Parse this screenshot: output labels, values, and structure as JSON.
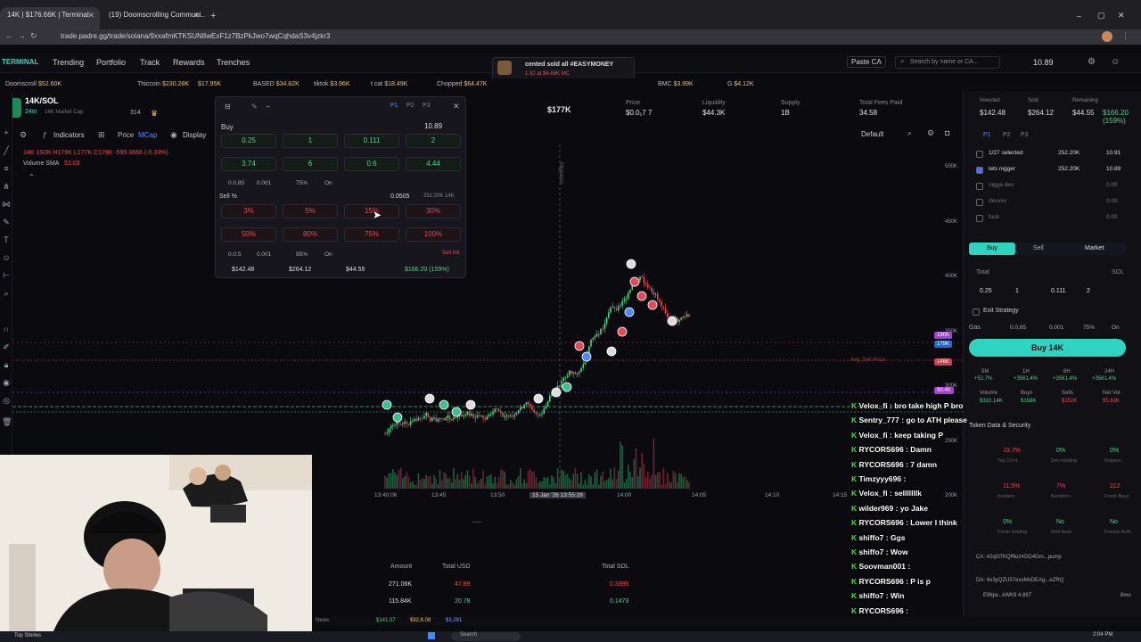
{
  "browser": {
    "tabs": [
      {
        "label": "14K | $176.66K | Terminal"
      },
      {
        "label": "(19) Doomscrolling Communi..."
      }
    ],
    "url": "trade.padre.gg/trade/solana/9xxafmKTKSUN8wExF1z7BzPkJwo7wqCqhdaS3v4jzkr3"
  },
  "nav": {
    "brand": "TERMINAL",
    "items": [
      "Trending",
      "Portfolio",
      "Track",
      "Rewards",
      "Trenches"
    ],
    "paste": "Paste CA",
    "search_placeholder": "Search by name or CA...",
    "balance": "10.89"
  },
  "notification": {
    "text": "cented sold all #EASYMONEY",
    "sub": "1.92 at $4.66K MC"
  },
  "ticker": [
    {
      "name": "Doomscroll",
      "value": "$52.60K"
    },
    {
      "name": "Thiccoin",
      "value": "$230.28K"
    },
    {
      "name": "",
      "value": "$17.95K"
    },
    {
      "name": "BASED",
      "value": "$34.82K"
    },
    {
      "name": "tiktok",
      "value": "$3.96K"
    },
    {
      "name": "t cat",
      "value": "$18.49K"
    },
    {
      "name": "Chopped",
      "value": "$64.47K"
    },
    {
      "name": "BMC",
      "value": "$3.99K"
    },
    {
      "name": "G",
      "value": "$4.12K"
    }
  ],
  "token": {
    "pair": "14K/SOL",
    "age": "24m",
    "subtitle": "14K Market Cap",
    "holders": "314",
    "ohlc": "14K 1S0K H179K L177K C179K -599.3666 (-0.33%)",
    "volume_label": "Volume SMA",
    "volume_value": "52.03"
  },
  "chart_toolbar": {
    "indicators": "Indicators",
    "price": "Price",
    "mcap": "MCap",
    "display": "Display",
    "default": "Default"
  },
  "stats": [
    {
      "label": "",
      "value": "$177K"
    },
    {
      "label": "Price",
      "value": "$0.0₁7 7"
    },
    {
      "label": "Liquidity",
      "value": "$44.3K"
    },
    {
      "label": "Supply",
      "value": "1B"
    },
    {
      "label": "Total Fees Paid",
      "value": "34.58"
    }
  ],
  "popup": {
    "buy_label": "Buy",
    "balance": "10.89",
    "buy_amounts": [
      "0.25",
      "1",
      "0.111",
      "2",
      "3.74",
      "6",
      "0.6",
      "4.44"
    ],
    "buy_settings": [
      "0.0,85",
      "0.001",
      "75%",
      "On"
    ],
    "sell_label": "Sell %",
    "sell_info": "0.0505",
    "sell_info2": "252.20K 14K",
    "sell_pcts": [
      "3%",
      "5%",
      "15%",
      "30%",
      "50%",
      "80%",
      "75%",
      "100%"
    ],
    "sell_settings": [
      "0.0,5",
      "0.001",
      "95%",
      "On"
    ],
    "sell_init": "Sell init",
    "totals": [
      "$142.48",
      "$264.12",
      "$44.55",
      "$166.20 (159%)"
    ]
  },
  "chart": {
    "price_axis": [
      "500K",
      "450K",
      "400K",
      "350K",
      "300K",
      "250K",
      "200K",
      "150K",
      "100K"
    ],
    "time_axis": [
      "13:40:06",
      "13:45",
      "13:50",
      "15 Jan '26 13:55:28",
      "14:00",
      "14:05",
      "14:10",
      "14:15"
    ],
    "tags": [
      {
        "text": "190K",
        "color": "#a23fd6"
      },
      {
        "text": "179K",
        "color": "#1e6bd6"
      },
      {
        "text": "146K",
        "color": "#d13b4c"
      },
      {
        "text": "90.4K",
        "color": "#a23fd6"
      }
    ],
    "avg_label": "Avg. Sell Price",
    "migration_label": "Migration"
  },
  "right_panel": {
    "invested": "$142.48",
    "sold": "$264.12",
    "remaining": "$44.55",
    "pnl": "$166.20 (159%)",
    "presets": [
      "P1",
      "P2",
      "P3"
    ],
    "wallets": [
      {
        "name": "1/27 selected",
        "value": "252.20K",
        "sol": "10.91"
      },
      {
        "name": "lets nigger",
        "value": "252.20K",
        "sol": "10.89"
      },
      {
        "name": "nigga dev",
        "value": "",
        "sol": "0.00"
      },
      {
        "name": "devvvv",
        "value": "",
        "sol": "0.00"
      },
      {
        "name": "fuck",
        "value": "",
        "sol": "0.00"
      }
    ],
    "tabs": [
      "Buy",
      "Sell",
      "Market"
    ],
    "amount_label": "Total",
    "currency": "SOL",
    "quick": [
      "0.25",
      "1",
      "0.111",
      "2"
    ],
    "exit_strategy": "Exit Strategy",
    "gas_label": "Gas",
    "gas": [
      "0.0,85",
      "0.001",
      "75%",
      "On"
    ],
    "buy_button": "Buy 14K",
    "timeframes": [
      {
        "tf": "5M",
        "v": "+52.7%"
      },
      {
        "tf": "1H",
        "v": "+3561.4%"
      },
      {
        "tf": "6H",
        "v": "+3561.4%"
      },
      {
        "tf": "24H",
        "v": "+3561.4%"
      }
    ],
    "volume_row": [
      "Volume",
      "Buys",
      "Sells",
      "Net Vol."
    ],
    "volume_vals": [
      "$310.14K",
      "$158K",
      "$152K",
      "$5.63K"
    ],
    "security_title": "Token Data & Security",
    "security": [
      {
        "v": "19.7%",
        "l": "Top 10 H."
      },
      {
        "v": "0%",
        "l": "Dev holding"
      },
      {
        "v": "0%",
        "l": "Snipers"
      },
      {
        "v": "11.5%",
        "l": "Insiders"
      },
      {
        "v": "7%",
        "l": "Bundlers"
      },
      {
        "v": "212",
        "l": "Fresh Buys"
      },
      {
        "v": "0%",
        "l": "Fresh holding"
      },
      {
        "v": "No",
        "l": "Mint Auth."
      },
      {
        "v": "No",
        "l": "Freeze Auth."
      }
    ],
    "ca": "CA: 42qt37KQRkcHGG4Gm...pump",
    "da": "DA: 4o3yQZU57exoMxDEAg...eZRQ",
    "dev": "E9fqw...kWK9 4.897",
    "dev_time": "8mo"
  },
  "chat": [
    {
      "user": "Velox_fi",
      "msg": "bro take high P bro"
    },
    {
      "user": "Sentry_777",
      "msg": "go to ATH please"
    },
    {
      "user": "Velox_fi",
      "msg": "keep taking P"
    },
    {
      "user": "RYCORS696",
      "msg": "Damn"
    },
    {
      "user": "RYCORS696",
      "msg": "7 damn"
    },
    {
      "user": "Timzyyy696",
      "msg": ""
    },
    {
      "user": "Velox_fi",
      "msg": "selllllllk"
    },
    {
      "user": "wilder969",
      "msg": "yo Jake"
    },
    {
      "user": "RYCORS696",
      "msg": "Lower I think"
    },
    {
      "user": "shiffo7",
      "msg": "Ggs"
    },
    {
      "user": "shiffo7",
      "msg": "Wow"
    },
    {
      "user": "Soovman001",
      "msg": ""
    },
    {
      "user": "RYCORS696",
      "msg": "P is p"
    },
    {
      "user": "shiffo7",
      "msg": "Win"
    },
    {
      "user": "RYCORS696",
      "msg": ""
    }
  ],
  "trades": {
    "headers": [
      "Amount",
      "Total USD",
      "Total SOL"
    ],
    "rows": [
      {
        "amount": "271.06K",
        "usd": "47.89",
        "sol": "0.3395",
        "side": "sell"
      },
      {
        "amount": "115.84K",
        "usd": "20.78",
        "sol": "0.1473",
        "side": "buy"
      }
    ]
  },
  "bottom": {
    "news": "News",
    "sol_price": "$141.07",
    "btc": "$92,6.08",
    "eth": "$3,281"
  },
  "taskbar": {
    "weather": "Top Stories",
    "search": "Search",
    "time": "2:04 PM",
    "date": "1/15/2026"
  },
  "colors": {
    "green": "#45d58c",
    "red": "#e44a5a",
    "accent": "#2fd4c0",
    "purple": "#8a4dff"
  }
}
